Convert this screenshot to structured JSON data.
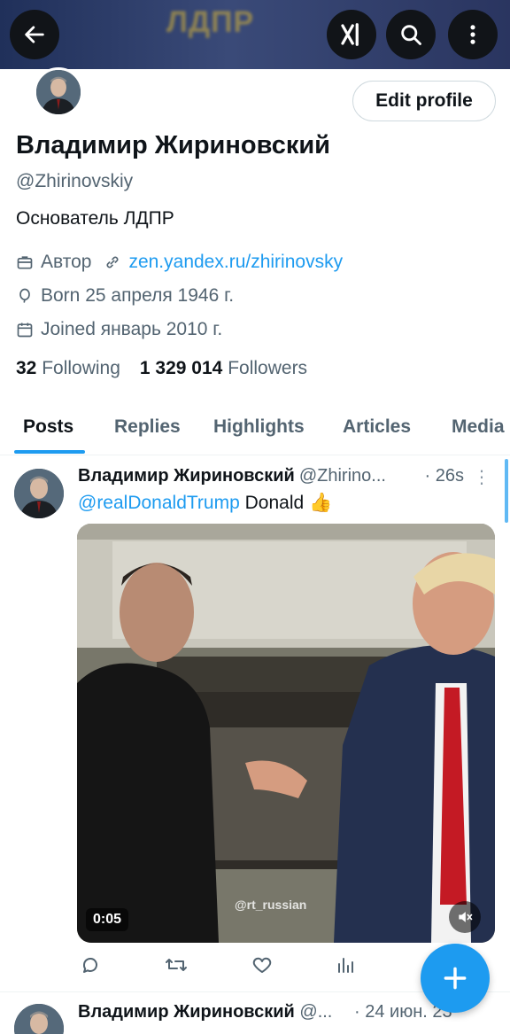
{
  "header": {
    "banner_text": "ЛДПР",
    "back_icon": "arrow-left-icon",
    "grok_icon": "grok-icon",
    "search_icon": "search-icon",
    "more_icon": "more-vertical-icon"
  },
  "profile": {
    "edit_label": "Edit profile",
    "name": "Владимир Жириновский",
    "handle": "@Zhirinovskiy",
    "bio": "Основатель ЛДПР",
    "category": "Автор",
    "website": "zen.yandex.ru/zhirinovsky",
    "born": "Born 25 апреля 1946 г.",
    "joined": "Joined январь 2010 г.",
    "following_count": "32",
    "following_label": "Following",
    "followers_count": "1 329 014",
    "followers_label": "Followers"
  },
  "tabs": [
    {
      "label": "Posts",
      "active": true
    },
    {
      "label": "Replies",
      "active": false
    },
    {
      "label": "Highlights",
      "active": false
    },
    {
      "label": "Articles",
      "active": false
    },
    {
      "label": "Media",
      "active": false
    }
  ],
  "post": {
    "author": "Владимир Жириновский",
    "handle": "@Zhirino...",
    "time": "· 26s",
    "mention": "@realDonaldTrump",
    "text": " Donald 👍",
    "video_duration": "0:05",
    "watermark": "@rt_russian"
  },
  "post2": {
    "author": "Владимир Жириновский",
    "handle": "@...",
    "time": "· 24 июн. 23"
  },
  "colors": {
    "accent": "#1d9bf0",
    "text_primary": "#0f1419",
    "text_secondary": "#536471"
  }
}
